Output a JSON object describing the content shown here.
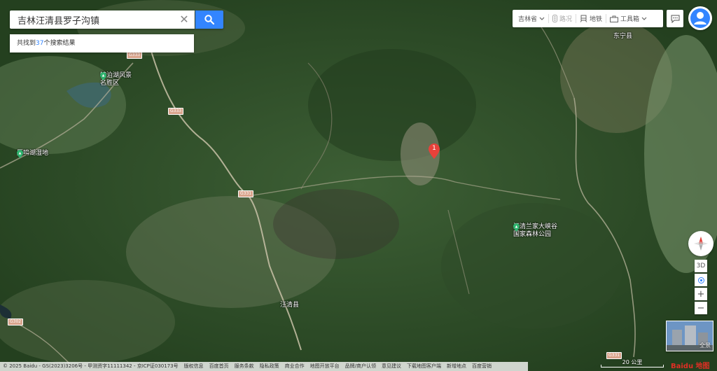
{
  "search": {
    "value": "吉林汪清县罗子沟镇",
    "clear_symbol": "✕",
    "results_prefix": "共找到",
    "results_count": "37",
    "results_suffix": "个搜索结果"
  },
  "toolbar": {
    "province": "吉林省",
    "traffic": "路况",
    "subway": "地铁",
    "tools": "工具箱"
  },
  "map": {
    "pois": [
      {
        "name_line1": "镜泊湖风景",
        "name_line2": "名胜区"
      },
      {
        "name_line1": "雁鸣湖湿地",
        "name_line2": ""
      },
      {
        "name_line1": "汪清兰家大峡谷",
        "name_line2": "国家森林公园"
      }
    ],
    "roads": [
      "G333",
      "G333",
      "G331",
      "G302",
      "G331"
    ],
    "towns": [
      "东宁县",
      "汪清县"
    ],
    "marker_label": "1"
  },
  "controls": {
    "three_d": "3D",
    "zoom_in": "+",
    "zoom_out": "−",
    "panorama": "全景"
  },
  "footer": {
    "copyright": "© 2025 Baidu - GS(2023)3206号 - 甲测资字11111342 - 京ICP证030173号",
    "links": [
      "版权信息",
      "百度首页",
      "服务条款",
      "隐私政策",
      "商业合作",
      "地图开放平台",
      "品牌/商户认领",
      "意见建议",
      "下载地图客户端",
      "新增地点",
      "百度营销"
    ]
  },
  "scale": {
    "label": "20 公里"
  },
  "logo": "Baidu 地图",
  "colors": {
    "accent": "#3385ff",
    "marker": "#e8413a",
    "poi": "#2fb36e"
  }
}
